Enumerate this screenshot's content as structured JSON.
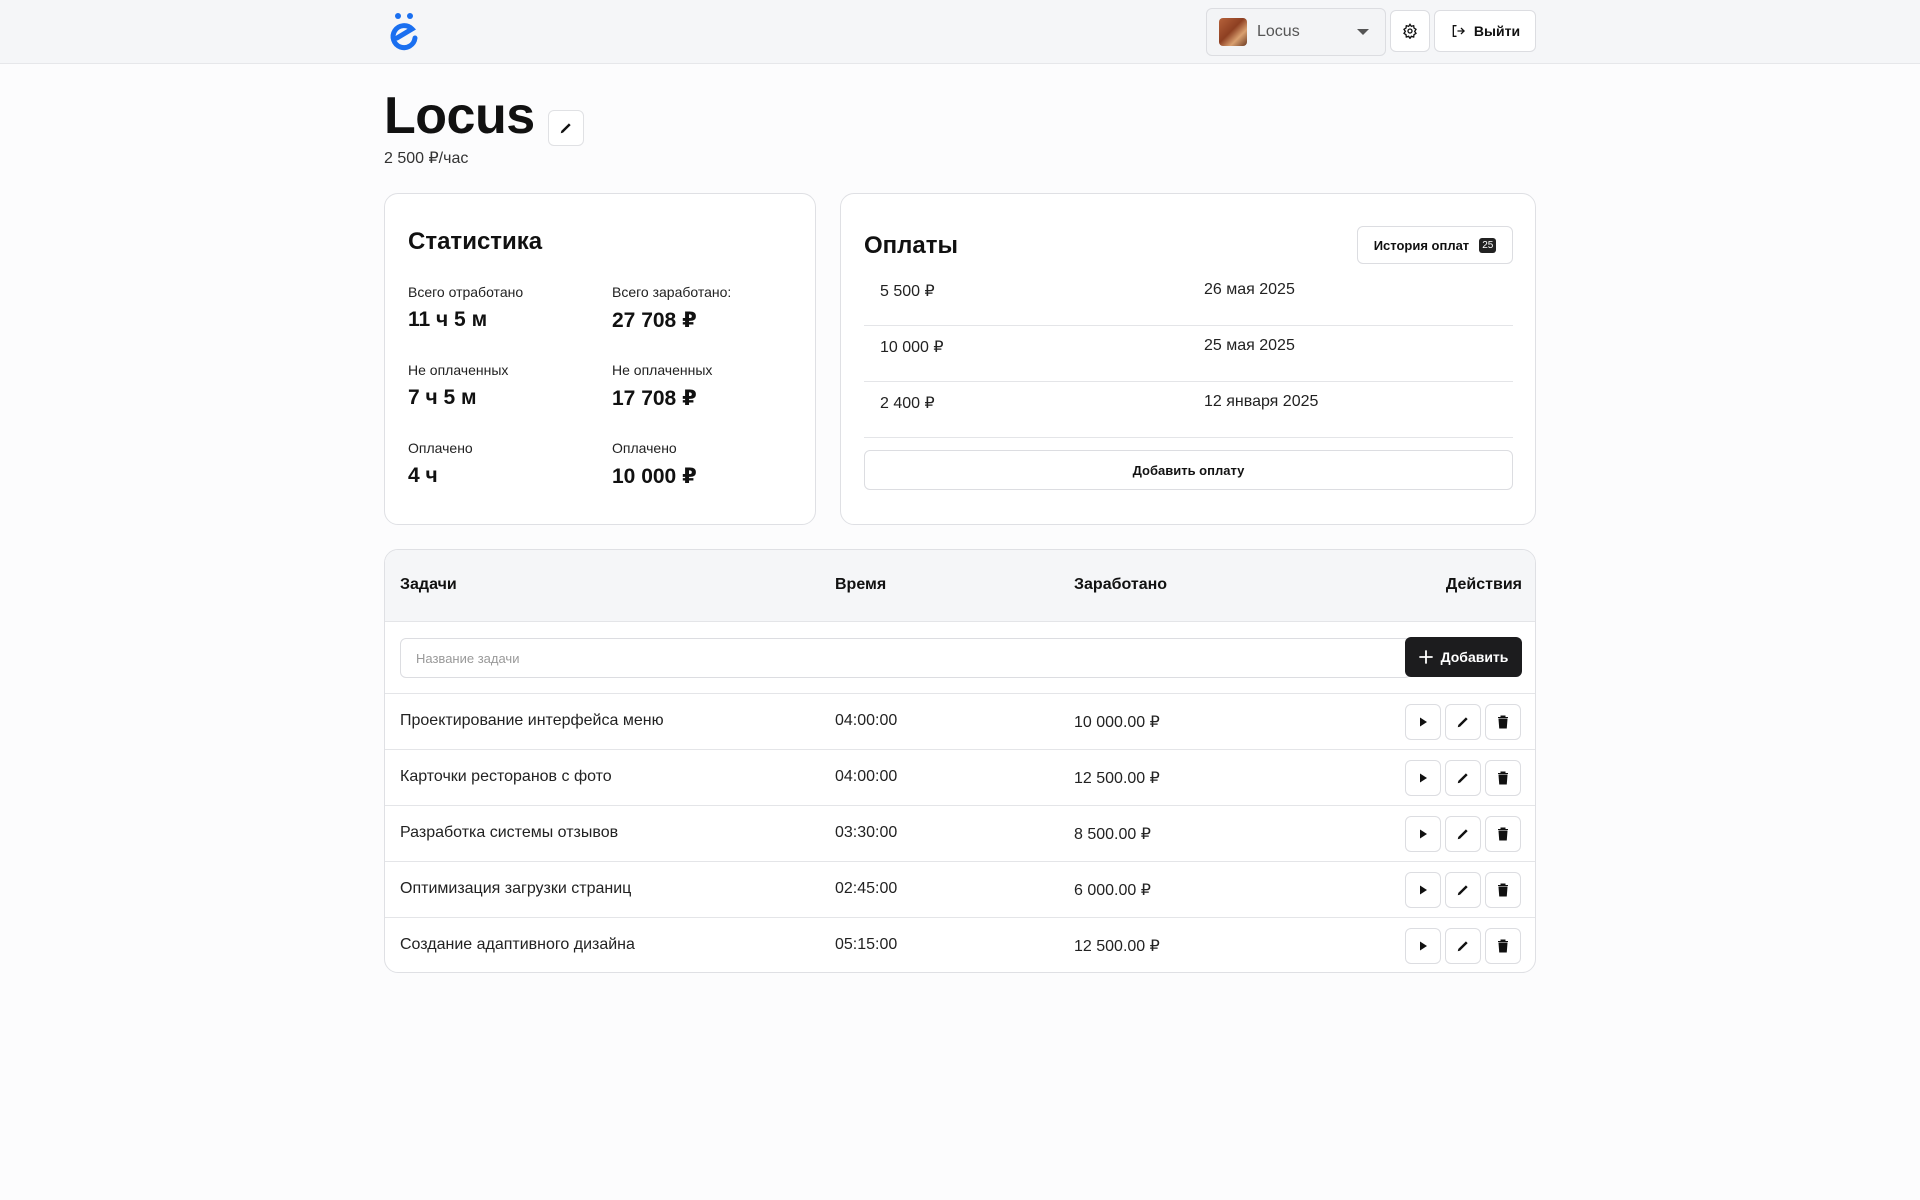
{
  "header": {
    "logo_icon": "yo-letter-logo-icon",
    "project_selector": {
      "selected": "Locus",
      "avatar_icon": "project-avatar-icon"
    },
    "settings_icon": "gear-icon",
    "logout_label": "Выйти",
    "logout_icon": "logout-icon"
  },
  "project": {
    "title": "Locus",
    "rate": "2 500 ₽/час"
  },
  "stats": {
    "title": "Статистика",
    "items": [
      {
        "label": "Всего отработано",
        "value": "11 ч 5 м"
      },
      {
        "label": "Всего заработано:",
        "value": "27 708 ₽"
      },
      {
        "label": "Не оплаченных",
        "value": "7 ч 5 м"
      },
      {
        "label": "Не оплаченных",
        "value": "17 708 ₽"
      },
      {
        "label": "Оплачено",
        "value": "4 ч"
      },
      {
        "label": "Оплачено",
        "value": "10 000 ₽"
      }
    ]
  },
  "payments": {
    "title": "Оплаты",
    "history_label": "История оплат",
    "history_count": "25",
    "rows": [
      {
        "amount": "5 500 ₽",
        "date": "26 мая 2025"
      },
      {
        "amount": "10 000 ₽",
        "date": "25 мая 2025"
      },
      {
        "amount": "2 400 ₽",
        "date": "12 января 2025"
      }
    ],
    "add_label": "Добавить оплату"
  },
  "tasks": {
    "columns": {
      "name": "Задачи",
      "time": "Время",
      "earned": "Заработано",
      "actions": "Действия"
    },
    "input_placeholder": "Название задачи",
    "input_value": "",
    "add_label": "Добавить",
    "rows": [
      {
        "name": "Проектирование интерфейса меню",
        "time": "04:00:00",
        "earned": "10 000.00 ₽"
      },
      {
        "name": "Карточки ресторанов с фото",
        "time": "04:00:00",
        "earned": "12 500.00 ₽"
      },
      {
        "name": "Разработка системы отзывов",
        "time": "03:30:00",
        "earned": "8 500.00 ₽"
      },
      {
        "name": "Оптимизация загрузки страниц",
        "time": "02:45:00",
        "earned": "6 000.00 ₽"
      },
      {
        "name": "Создание адаптивного дизайна",
        "time": "05:15:00",
        "earned": "12 500.00 ₽"
      }
    ],
    "row_action_icons": [
      "play-icon",
      "pencil-icon",
      "trash-icon"
    ]
  },
  "colors": {
    "accent_blue": "#1a6ff0",
    "primary_dark": "#1c1c1e",
    "header_bg": "#f5f6f8"
  }
}
